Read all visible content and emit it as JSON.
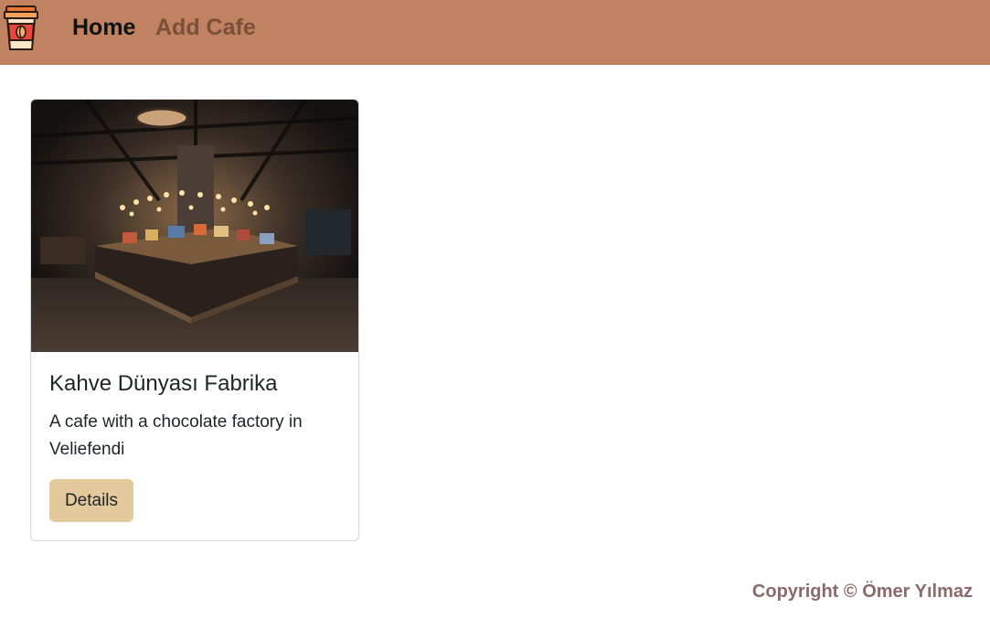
{
  "navbar": {
    "logo_icon": "coffee-cup-icon",
    "home_label": "Home",
    "add_cafe_label": "Add Cafe",
    "background_color": "#c18262"
  },
  "cards": [
    {
      "image_icon": "cafe-interior-image",
      "title": "Kahve Dünyası Fabrika",
      "description": "A cafe with a chocolate factory in Veliefendi",
      "button_label": "Details",
      "button_color": "#e3c99b"
    }
  ],
  "footer": {
    "copyright": "Copyright © Ömer Yılmaz"
  }
}
